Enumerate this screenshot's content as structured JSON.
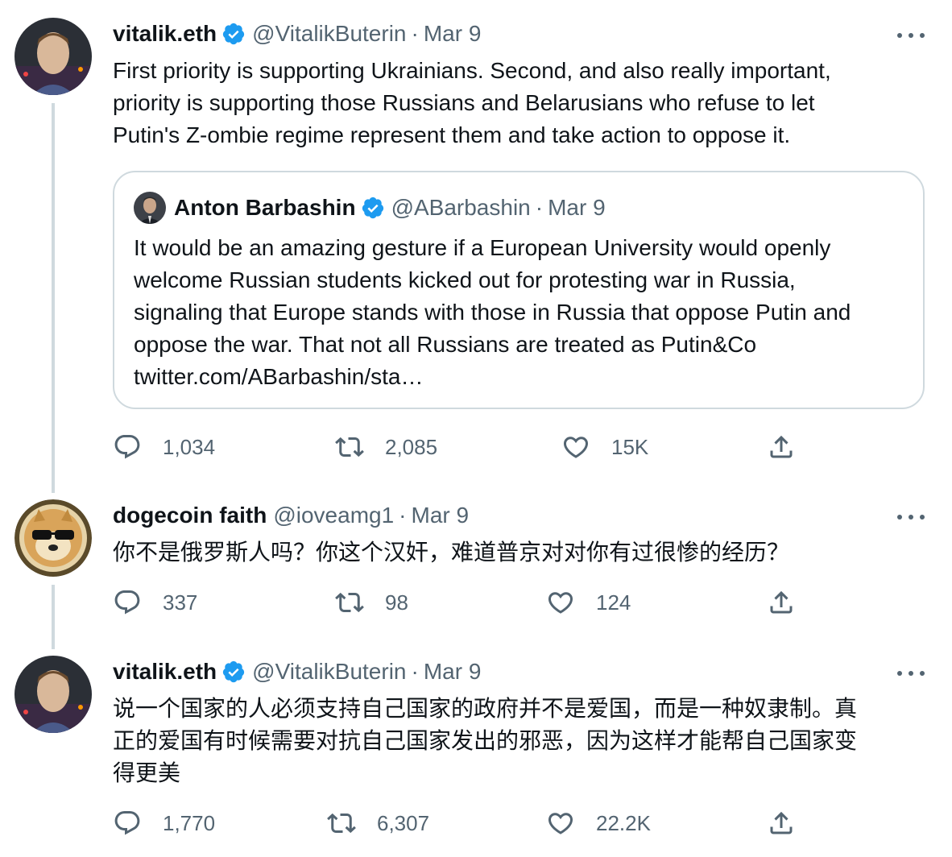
{
  "tweets": [
    {
      "name": "vitalik.eth",
      "handle": "@VitalikButerin",
      "date": "Mar 9",
      "verified": true,
      "text_lines": [
        "First priority is supporting Ukrainians. Second, and also really important,",
        "priority is supporting those Russians and Belarusians who refuse to let",
        "Putin's Z-ombie regime represent them and take action to oppose it."
      ],
      "quote": {
        "name": "Anton Barbashin",
        "handle": "@ABarbashin",
        "date": "Mar 9",
        "text_lines": [
          "It would be an amazing gesture if a European University would openly",
          "welcome Russian students kicked out for protesting war in Russia,",
          "signaling that Europe stands with those in Russia that oppose Putin and",
          "oppose the war. That not all Russians are treated as Putin&Co",
          "twitter.com/ABarbashin/sta…"
        ]
      },
      "replies": "1,034",
      "retweets": "2,085",
      "likes": "15K"
    },
    {
      "name": "dogecoin faith",
      "handle": "@ioveamg1",
      "date": "Mar 9",
      "verified": false,
      "text_lines": [
        "你不是俄罗斯人吗？你这个汉奸，难道普京对对你有过很惨的经历？"
      ],
      "replies": "337",
      "retweets": "98",
      "likes": "124"
    },
    {
      "name": "vitalik.eth",
      "handle": "@VitalikButerin",
      "date": "Mar 9",
      "verified": true,
      "text_lines": [
        "说一个国家的人必须支持自己国家的政府并不是爱国，而是一种奴隶制。真",
        "正的爱国有时候需要对抗自己国家发出的邪恶，因为这样才能帮自己国家变",
        "得更美"
      ],
      "replies": "1,770",
      "retweets": "6,307",
      "likes": "22.2K"
    }
  ],
  "icons": {
    "reply": "reply-icon",
    "retweet": "retweet-icon",
    "like": "heart-icon",
    "share": "share-icon",
    "more": "more-icon",
    "verified": "verified-badge-icon"
  },
  "colors": {
    "text": "#0f1419",
    "muted": "#536471",
    "verified": "#1d9bf0",
    "border": "#cfd9de"
  }
}
